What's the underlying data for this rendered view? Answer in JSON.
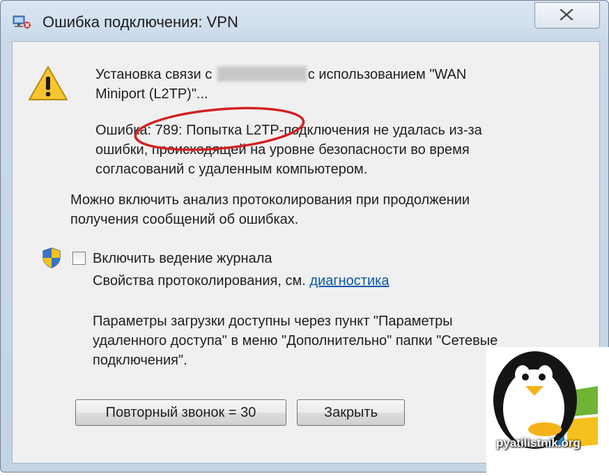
{
  "window": {
    "title": "Ошибка подключения: VPN"
  },
  "message": {
    "line1_prefix": "Установка связи с",
    "line1_suffix": "с использованием \"WAN",
    "line2": "Miniport (L2TP)\"...",
    "error_lines": [
      "Ошибка: 789: Попытка L2TP-подключения не удалась из-за",
      "ошибки, происходящей на уровне безопасности во время",
      "согласований с удаленным компьютером."
    ]
  },
  "info": {
    "lines": [
      "Можно включить анализ протоколирования при продолжении",
      "получения сообщений об ошибках."
    ]
  },
  "logging": {
    "checkbox_label": "Включить ведение журнала",
    "checked": false,
    "props_text": "Свойства протоколирования, см.",
    "props_link": "диагностика"
  },
  "params": {
    "lines": [
      "Параметры загрузки доступны через пункт \"Параметры",
      "удаленного доступа\" в меню \"Дополнительно\" папки \"Сетевые",
      "подключения\"."
    ]
  },
  "buttons": {
    "redial": "Повторный звонок = 30",
    "close": "Закрыть"
  },
  "watermark": {
    "text": "pyatilistnik.org"
  },
  "colors": {
    "link": "#0b57a8",
    "highlight_ellipse": "#d42020"
  }
}
